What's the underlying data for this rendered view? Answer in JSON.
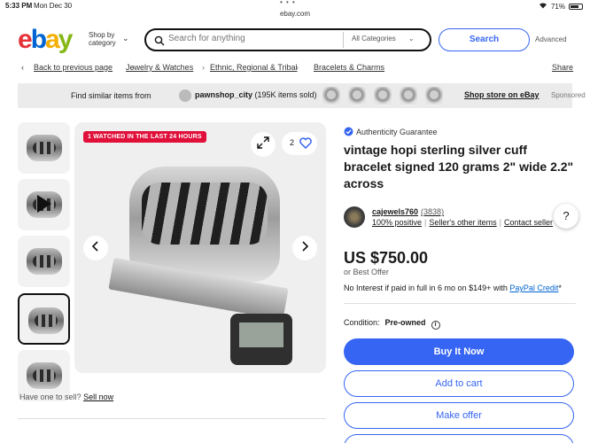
{
  "status_bar": {
    "time": "5:33 PM",
    "date": "Mon Dec 30",
    "url": "ebay.com",
    "battery": "71%"
  },
  "header": {
    "logo": {
      "e": "e",
      "b": "b",
      "a": "a",
      "y": "y"
    },
    "shop_by_category": "Shop by category",
    "search_placeholder": "Search for anything",
    "category_select": "All Categories",
    "search_button": "Search",
    "advanced": "Advanced"
  },
  "breadcrumb": {
    "back": "Back to previous page",
    "items": [
      "Jewelry & Watches",
      "Ethnic, Regional & Tribal",
      "Bracelets & Charms"
    ],
    "share": "Share"
  },
  "banner": {
    "find_similar": "Find similar items from",
    "seller": "pawnshop_city",
    "seller_info": "(195K items sold)",
    "store_link": "Shop store on eBay",
    "sponsored": "Sponsored"
  },
  "gallery": {
    "watched_badge": "1 WATCHED IN THE LAST 24 HOURS",
    "watch_count": "2",
    "sell_prompt": "Have one to sell?",
    "sell_link": "Sell now"
  },
  "item": {
    "authenticity": "Authenticity Guarantee",
    "title": "vintage hopi sterling silver cuff bracelet signed 120 grams 2\" wide 2.2\" across",
    "seller_name": "cajewels760",
    "seller_feedback": "(3838)",
    "positive": "100% positive",
    "other_items": "Seller's other items",
    "contact": "Contact seller",
    "price": "US $750.00",
    "best_offer": "or Best Offer",
    "interest_text": "No Interest if paid in full in 6 mo on $149+ with",
    "paypal_credit": "PayPal Credit",
    "paypal_mark": "*",
    "condition_label": "Condition:",
    "condition_value": "Pre-owned",
    "buy_now": "Buy It Now",
    "add_to_cart": "Add to cart",
    "make_offer": "Make offer"
  },
  "colors": {
    "ebay_blue": "#3665f3",
    "badge_red": "#e0103a"
  }
}
